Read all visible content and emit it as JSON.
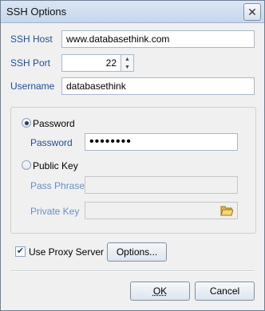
{
  "window": {
    "title": "SSH Options",
    "close_glyph": "✕"
  },
  "fields": {
    "ssh_host": {
      "label": "SSH Host",
      "value": "www.databasethink.com"
    },
    "ssh_port": {
      "label": "SSH Port",
      "value": "22"
    },
    "username": {
      "label": "Username",
      "value": "databasethink"
    }
  },
  "auth": {
    "password_option": {
      "label": "Password",
      "selected": true
    },
    "password_field": {
      "label": "Password",
      "value": "••••••••"
    },
    "public_key_option": {
      "label": "Public Key",
      "selected": false
    },
    "pass_phrase": {
      "label": "Pass Phrase",
      "value": ""
    },
    "private_key": {
      "label": "Private Key",
      "value": "",
      "browse_icon": "folder-open-icon"
    }
  },
  "proxy": {
    "label": "Use Proxy Server",
    "checked": true,
    "options_button": "Options..."
  },
  "buttons": {
    "ok": "OK",
    "cancel": "Cancel"
  },
  "colors": {
    "label_blue": "#1d4e9a",
    "label_disabled": "#6a8fc2",
    "window_bg": "#f0f0f0"
  }
}
